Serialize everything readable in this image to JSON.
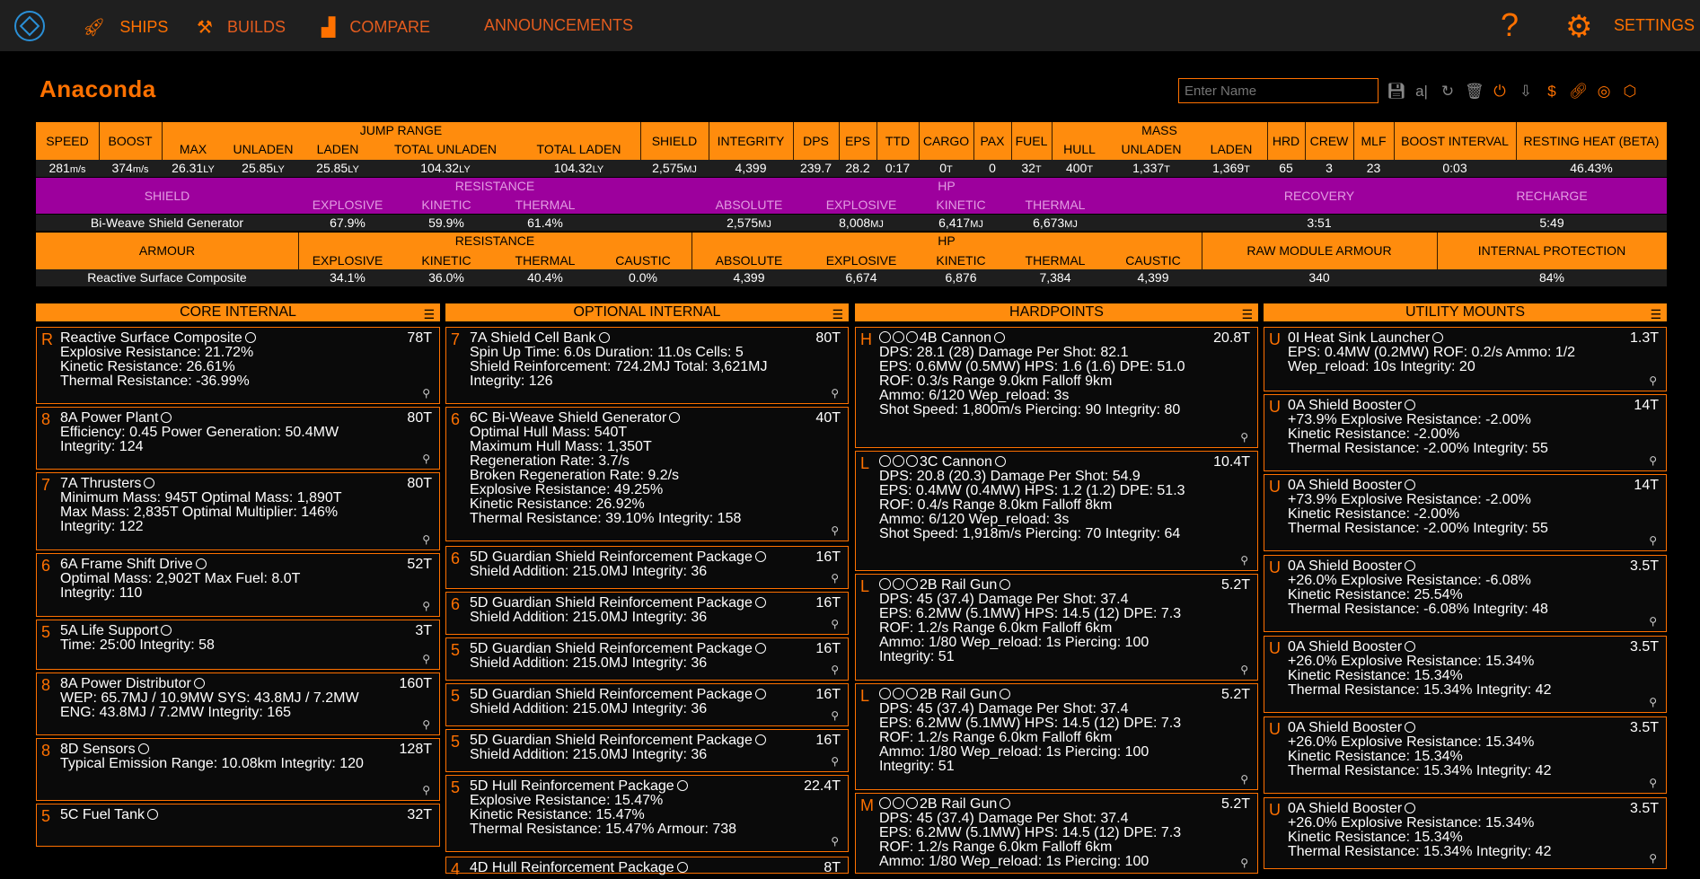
{
  "nav": {
    "ships": "SHIPS",
    "builds": "BUILDS",
    "compare": "COMPARE",
    "announcements": "ANNOUNCEMENTS",
    "help": "?",
    "settings": "SETTINGS"
  },
  "ship_title": "Anaconda",
  "name_input": {
    "placeholder": "Enter Name",
    "value": ""
  },
  "tools": [
    "save-icon",
    "rename-icon",
    "reload-icon",
    "delete-icon",
    "power-icon",
    "export-icon",
    "cost-icon",
    "link-icon",
    "eddb-icon",
    "coriolis-icon"
  ],
  "stats": {
    "headers": {
      "speed": "SPEED",
      "boost": "BOOST",
      "jump_range": "JUMP RANGE",
      "max": "MAX",
      "unladen": "UNLADEN",
      "laden": "LADEN",
      "total_unladen": "TOTAL UNLADEN",
      "total_laden": "TOTAL LADEN",
      "shield": "SHIELD",
      "integrity": "INTEGRITY",
      "dps": "DPS",
      "eps": "EPS",
      "ttd": "TTD",
      "cargo": "CARGO",
      "pax": "PAX",
      "fuel": "FUEL",
      "mass": "MASS",
      "hull": "HULL",
      "mass_unladen": "UNLADEN",
      "mass_laden": "LADEN",
      "hrd": "HRD",
      "crew": "CREW",
      "mlf": "MLF",
      "boost_interval": "BOOST INTERVAL",
      "resting_heat": "RESTING HEAT (BETA)"
    },
    "values": {
      "speed": "281",
      "speed_u": "m/s",
      "boost": "374",
      "boost_u": "m/s",
      "max": "26.31",
      "unladen": "25.85",
      "laden": "25.85",
      "ly": "LY",
      "total_unladen": "104.32",
      "total_laden": "104.32",
      "shield": "2,575",
      "mj": "MJ",
      "integrity": "4,399",
      "dps": "239.7",
      "eps": "28.2",
      "ttd": "0:17",
      "cargo": "0",
      "t": "T",
      "pax": "0",
      "fuel": "32",
      "hull": "400",
      "mass_unladen": "1,337",
      "mass_laden": "1,369",
      "hrd": "65",
      "crew": "3",
      "mlf": "23",
      "boost_interval": "0:03",
      "resting_heat": "46.43%"
    }
  },
  "shield_table": {
    "headers": {
      "shield": "SHIELD",
      "resistance": "RESISTANCE",
      "explosive": "EXPLOSIVE",
      "kinetic": "KINETIC",
      "thermal": "THERMAL",
      "hp": "HP",
      "absolute": "ABSOLUTE",
      "recovery": "RECOVERY",
      "recharge": "RECHARGE"
    },
    "values": {
      "name": "Bi-Weave Shield Generator",
      "r_explosive": "67.9%",
      "r_kinetic": "59.9%",
      "r_thermal": "61.4%",
      "hp_absolute": "2,575",
      "hp_explosive": "8,008",
      "hp_kinetic": "6,417",
      "hp_thermal": "6,673",
      "mj": "MJ",
      "recovery": "3:51",
      "recharge": "5:49"
    }
  },
  "armour_table": {
    "headers": {
      "armour": "ARMOUR",
      "resistance": "RESISTANCE",
      "explosive": "EXPLOSIVE",
      "kinetic": "KINETIC",
      "thermal": "THERMAL",
      "caustic": "CAUSTIC",
      "hp": "HP",
      "absolute": "ABSOLUTE",
      "raw": "RAW MODULE ARMOUR",
      "protection": "INTERNAL PROTECTION"
    },
    "values": {
      "name": "Reactive Surface Composite",
      "r_explosive": "34.1%",
      "r_kinetic": "36.0%",
      "r_thermal": "40.4%",
      "r_caustic": "0.0%",
      "hp_absolute": "4,399",
      "hp_explosive": "6,674",
      "hp_kinetic": "6,876",
      "hp_thermal": "7,384",
      "hp_caustic": "4,399",
      "raw": "340",
      "protection": "84%"
    }
  },
  "columns": {
    "core": "CORE INTERNAL",
    "optional": "OPTIONAL INTERNAL",
    "hardpoints": "HARDPOINTS",
    "utility": "UTILITY MOUNTS"
  },
  "core_modules": [
    {
      "cls": "R",
      "name": "Reactive Surface Composite",
      "mass": "78T",
      "lines": [
        "Explosive Resistance: 21.72%",
        "Kinetic Resistance: 26.61%",
        "Thermal Resistance: -36.99%"
      ]
    },
    {
      "cls": "8",
      "name": "8A Power Plant",
      "mass": "80T",
      "lines": [
        "Efficiency: 0.45   Power Generation: 50.4MW",
        "Integrity: 124"
      ]
    },
    {
      "cls": "7",
      "name": "7A Thrusters",
      "mass": "80T",
      "lines": [
        "Minimum Mass: 945T   Optimal Mass: 1,890T",
        "Max Mass: 2,835T   Optimal Multiplier: 146%",
        "Integrity: 122"
      ]
    },
    {
      "cls": "6",
      "name": "6A Frame Shift Drive",
      "mass": "52T",
      "lines": [
        "Optimal Mass: 2,902T   Max Fuel: 8.0T",
        "Integrity: 110"
      ]
    },
    {
      "cls": "5",
      "name": "5A Life Support",
      "mass": "3T",
      "lines": [
        "Time: 25:00   Integrity: 58"
      ]
    },
    {
      "cls": "8",
      "name": "8A Power Distributor",
      "mass": "160T",
      "lines": [
        "WEP: 65.7MJ / 10.9MW   SYS: 43.8MJ / 7.2MW",
        "ENG: 43.8MJ / 7.2MW   Integrity: 165"
      ]
    },
    {
      "cls": "8",
      "name": "8D Sensors",
      "mass": "128T",
      "lines": [
        "Typical Emission Range: 10.08km   Integrity: 120"
      ]
    },
    {
      "cls": "5",
      "name": "5C Fuel Tank",
      "mass": "32T",
      "lines": []
    }
  ],
  "optional_modules": [
    {
      "cls": "7",
      "name": "7A Shield Cell Bank",
      "mass": "80T",
      "lines": [
        "Spin Up Time: 6.0s   Duration: 11.0s   Cells: 5",
        "Shield Reinforcement: 724.2MJ   Total: 3,621MJ",
        "Integrity: 126"
      ]
    },
    {
      "cls": "6",
      "name": "6C Bi-Weave Shield Generator",
      "mass": "40T",
      "lines": [
        "Optimal Hull Mass: 540T",
        "Maximum Hull Mass: 1,350T",
        "Regeneration Rate: 3.7/s",
        "Broken Regeneration Rate: 9.2/s",
        "Explosive Resistance: 49.25%",
        "Kinetic Resistance: 26.92%",
        "Thermal Resistance: 39.10%   Integrity: 158"
      ]
    },
    {
      "cls": "6",
      "name": "5D Guardian Shield Reinforcement Package",
      "mass": "16T",
      "lines": [
        "Shield Addition: 215.0MJ   Integrity: 36"
      ]
    },
    {
      "cls": "6",
      "name": "5D Guardian Shield Reinforcement Package",
      "mass": "16T",
      "lines": [
        "Shield Addition: 215.0MJ   Integrity: 36"
      ]
    },
    {
      "cls": "5",
      "name": "5D Guardian Shield Reinforcement Package",
      "mass": "16T",
      "lines": [
        "Shield Addition: 215.0MJ   Integrity: 36"
      ]
    },
    {
      "cls": "5",
      "name": "5D Guardian Shield Reinforcement Package",
      "mass": "16T",
      "lines": [
        "Shield Addition: 215.0MJ   Integrity: 36"
      ]
    },
    {
      "cls": "5",
      "name": "5D Guardian Shield Reinforcement Package",
      "mass": "16T",
      "lines": [
        "Shield Addition: 215.0MJ   Integrity: 36"
      ]
    },
    {
      "cls": "5",
      "name": "5D Hull Reinforcement Package",
      "mass": "22.4T",
      "lines": [
        "Explosive Resistance: 15.47%",
        "Kinetic Resistance: 15.47%",
        "Thermal Resistance: 15.47%   Armour: 738"
      ]
    },
    {
      "cls": "4",
      "name": "4D Hull Reinforcement Package",
      "mass": "8T",
      "lines": []
    }
  ],
  "hardpoints": [
    {
      "cls": "H",
      "name": "4B Cannon",
      "mass": "20.8T",
      "lines": [
        "DPS: 28.1 (28)   Damage Per Shot: 82.1",
        "EPS: 0.6MW (0.5MW)   HPS: 1.6 (1.6)   DPE: 51.0",
        "ROF: 0.3/s   Range 9.0km   Falloff 9km",
        "Ammo: 6/120   Wep_reload: 3s",
        "Shot Speed: 1,800m/s   Piercing: 90   Integrity: 80"
      ]
    },
    {
      "cls": "L",
      "name": "3C Cannon",
      "mass": "10.4T",
      "lines": [
        "DPS: 20.8 (20.3)   Damage Per Shot: 54.9",
        "EPS: 0.4MW (0.4MW)   HPS: 1.2 (1.2)   DPE: 51.3",
        "ROF: 0.4/s   Range 8.0km   Falloff 8km",
        "Ammo: 6/120   Wep_reload: 3s",
        "Shot Speed: 1,918m/s   Piercing: 70   Integrity: 64"
      ]
    },
    {
      "cls": "L",
      "name": "2B Rail Gun",
      "mass": "5.2T",
      "lines": [
        "DPS: 45 (37.4)   Damage Per Shot: 37.4",
        "EPS: 6.2MW (5.1MW)   HPS: 14.5 (12)   DPE: 7.3",
        "ROF: 1.2/s   Range 6.0km   Falloff 6km",
        "Ammo: 1/80   Wep_reload: 1s   Piercing: 100",
        "Integrity: 51"
      ]
    },
    {
      "cls": "L",
      "name": "2B Rail Gun",
      "mass": "5.2T",
      "lines": [
        "DPS: 45 (37.4)   Damage Per Shot: 37.4",
        "EPS: 6.2MW (5.1MW)   HPS: 14.5 (12)   DPE: 7.3",
        "ROF: 1.2/s   Range 6.0km   Falloff 6km",
        "Ammo: 1/80   Wep_reload: 1s   Piercing: 100",
        "Integrity: 51"
      ]
    },
    {
      "cls": "M",
      "name": "2B Rail Gun",
      "mass": "5.2T",
      "lines": [
        "DPS: 45 (37.4)   Damage Per Shot: 37.4",
        "EPS: 6.2MW (5.1MW)   HPS: 14.5 (12)   DPE: 7.3",
        "ROF: 1.2/s   Range 6.0km   Falloff 6km",
        "Ammo: 1/80   Wep_reload: 1s   Piercing: 100"
      ]
    }
  ],
  "utility": [
    {
      "cls": "U",
      "name": "0I Heat Sink Launcher",
      "mass": "1.3T",
      "lines": [
        "EPS: 0.4MW (0.2MW)   ROF: 0.2/s   Ammo: 1/2",
        "Wep_reload: 10s   Integrity: 20"
      ]
    },
    {
      "cls": "U",
      "name": "0A Shield Booster",
      "mass": "14T",
      "lines": [
        "+73.9%   Explosive Resistance: -2.00%",
        "Kinetic Resistance: -2.00%",
        "Thermal Resistance: -2.00%   Integrity: 55"
      ]
    },
    {
      "cls": "U",
      "name": "0A Shield Booster",
      "mass": "14T",
      "lines": [
        "+73.9%   Explosive Resistance: -2.00%",
        "Kinetic Resistance: -2.00%",
        "Thermal Resistance: -2.00%   Integrity: 55"
      ]
    },
    {
      "cls": "U",
      "name": "0A Shield Booster",
      "mass": "3.5T",
      "lines": [
        "+26.0%   Explosive Resistance: -6.08%",
        "Kinetic Resistance: 25.54%",
        "Thermal Resistance: -6.08%   Integrity: 48"
      ]
    },
    {
      "cls": "U",
      "name": "0A Shield Booster",
      "mass": "3.5T",
      "lines": [
        "+26.0%   Explosive Resistance: 15.34%",
        "Kinetic Resistance: 15.34%",
        "Thermal Resistance: 15.34%   Integrity: 42"
      ]
    },
    {
      "cls": "U",
      "name": "0A Shield Booster",
      "mass": "3.5T",
      "lines": [
        "+26.0%   Explosive Resistance: 15.34%",
        "Kinetic Resistance: 15.34%",
        "Thermal Resistance: 15.34%   Integrity: 42"
      ]
    },
    {
      "cls": "U",
      "name": "0A Shield Booster",
      "mass": "3.5T",
      "lines": [
        "+26.0%   Explosive Resistance: 15.34%",
        "Kinetic Resistance: 15.34%",
        "Thermal Resistance: 15.34%   Integrity: 42"
      ]
    }
  ],
  "colors": {
    "accent": "#ff7100",
    "header_bar": "#ff8c0d",
    "shield_bar": "#9d009d",
    "panel_bg": "#0a0a0a"
  }
}
